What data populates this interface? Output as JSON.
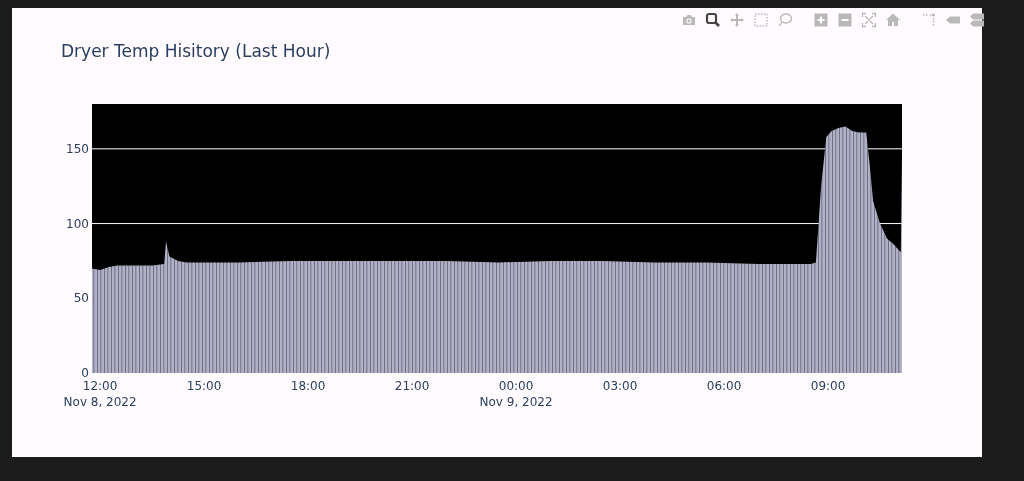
{
  "toolbar": [
    {
      "kind": "camera",
      "selected": false
    },
    {
      "kind": "zoom",
      "selected": true
    },
    {
      "kind": "pan",
      "selected": false
    },
    {
      "kind": "box-select",
      "selected": false
    },
    {
      "kind": "lasso",
      "selected": false
    },
    {
      "kind": "zoom-in",
      "selected": false
    },
    {
      "kind": "zoom-out",
      "selected": false
    },
    {
      "kind": "autoscale",
      "selected": false
    },
    {
      "kind": "home",
      "selected": false
    },
    {
      "kind": "spikelines",
      "selected": false
    },
    {
      "kind": "hover-closest",
      "selected": false
    },
    {
      "kind": "hover-compare",
      "selected": false
    }
  ],
  "chart": {
    "title": "Dryer Temp Hisitory (Last Hour)",
    "chart_data": {
      "type": "area",
      "xlim": [
        "2022-11-08T11:46",
        "2022-11-09T11:08"
      ],
      "ylim": [
        0,
        180
      ],
      "xticks": [
        {
          "value": "2022-11-08T12:00",
          "label": "12:00\nNov 8, 2022"
        },
        {
          "value": "2022-11-08T15:00",
          "label": "15:00"
        },
        {
          "value": "2022-11-08T18:00",
          "label": "18:00"
        },
        {
          "value": "2022-11-08T21:00",
          "label": "21:00"
        },
        {
          "value": "2022-11-09T00:00",
          "label": "00:00\nNov 9, 2022"
        },
        {
          "value": "2022-11-09T03:00",
          "label": "03:00"
        },
        {
          "value": "2022-11-09T06:00",
          "label": "06:00"
        },
        {
          "value": "2022-11-09T09:00",
          "label": "09:00"
        }
      ],
      "yticks": [
        0,
        50,
        100,
        150
      ],
      "x": [
        "2022-11-08T11:46",
        "2022-11-08T12:00",
        "2022-11-08T12:15",
        "2022-11-08T12:30",
        "2022-11-08T13:00",
        "2022-11-08T13:30",
        "2022-11-08T13:51",
        "2022-11-08T13:54",
        "2022-11-08T14:00",
        "2022-11-08T14:15",
        "2022-11-08T14:30",
        "2022-11-08T16:00",
        "2022-11-08T17:30",
        "2022-11-08T19:00",
        "2022-11-08T20:30",
        "2022-11-08T22:00",
        "2022-11-08T23:30",
        "2022-11-09T01:00",
        "2022-11-09T02:30",
        "2022-11-09T04:00",
        "2022-11-09T05:30",
        "2022-11-09T07:00",
        "2022-11-09T08:30",
        "2022-11-09T08:39",
        "2022-11-09T08:48",
        "2022-11-09T08:57",
        "2022-11-09T09:06",
        "2022-11-09T09:18",
        "2022-11-09T09:30",
        "2022-11-09T09:42",
        "2022-11-09T09:54",
        "2022-11-09T10:06",
        "2022-11-09T10:12",
        "2022-11-09T10:18",
        "2022-11-09T10:30",
        "2022-11-09T10:42",
        "2022-11-09T10:54",
        "2022-11-09T11:03",
        "2022-11-09T11:06",
        "2022-11-09T11:08"
      ],
      "series": [
        {
          "color": "#b0b1c6",
          "values": [
            70,
            69,
            71,
            72,
            72,
            72,
            73,
            88,
            78,
            75,
            74,
            74,
            75,
            75,
            75,
            75,
            74,
            75,
            75,
            74,
            74,
            73,
            73,
            74,
            125,
            158,
            162,
            164,
            165,
            162,
            161,
            161,
            140,
            115,
            100,
            90,
            86,
            82,
            81,
            145
          ]
        }
      ]
    }
  }
}
